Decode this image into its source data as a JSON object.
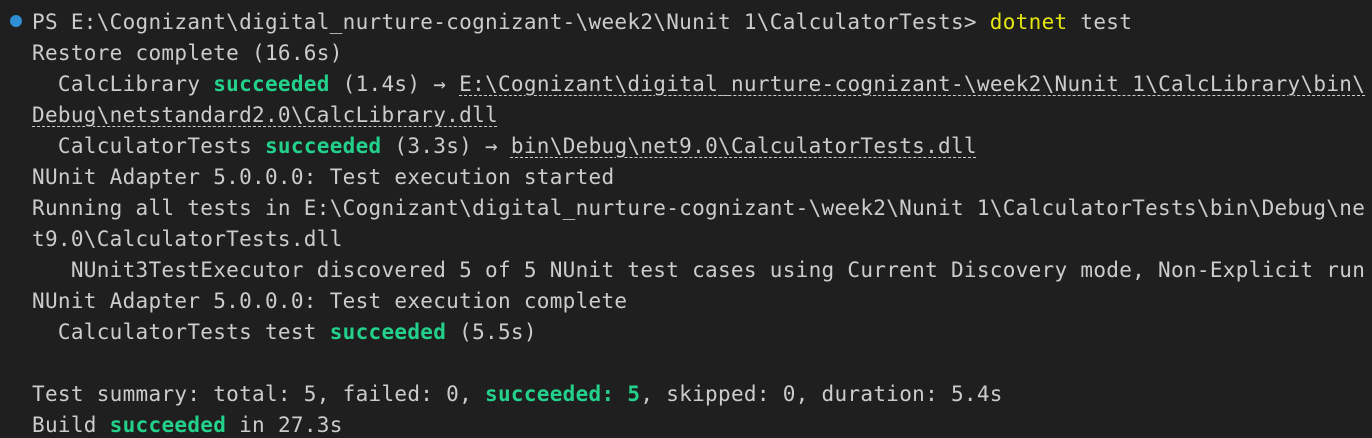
{
  "terminal": {
    "prompt": "PS E:\\Cognizant\\digital_nurture-cognizant-\\week2\\Nunit 1\\CalculatorTests> ",
    "command": "dotnet",
    "command_arg": " test",
    "restore": "Restore complete (16.6s)",
    "calclib": {
      "indent": "  ",
      "project": "CalcLibrary ",
      "status": "succeeded",
      "time": " (1.4s) → ",
      "path_line1": "E:\\Cognizant\\digital_nurture-cognizant-\\week2\\Nunit 1\\CalcLibrary\\bin\\",
      "path_line2": "Debug\\netstandard2.0\\CalcLibrary.dll"
    },
    "calctests": {
      "indent": "  ",
      "project": "CalculatorTests ",
      "status": "succeeded",
      "time": " (3.3s) → ",
      "path": "bin\\Debug\\net9.0\\CalculatorTests.dll"
    },
    "adapter_started": "NUnit Adapter 5.0.0.0: Test execution started",
    "running_line1": "Running all tests in E:\\Cognizant\\digital_nurture-cognizant-\\week2\\Nunit 1\\CalculatorTests\\bin\\Debug\\ne",
    "running_line2": "t9.0\\CalculatorTests.dll",
    "discovered": "   NUnit3TestExecutor discovered 5 of 5 NUnit test cases using Current Discovery mode, Non-Explicit run",
    "adapter_complete": "NUnit Adapter 5.0.0.0: Test execution complete",
    "test_result": {
      "indent": "  ",
      "prefix": "CalculatorTests test ",
      "status": "succeeded",
      "time": " (5.5s)"
    },
    "summary": {
      "prefix": "Test summary: total: 5, failed: 0, ",
      "succeeded": "succeeded: 5",
      "suffix": ", skipped: 0, duration: 5.4s"
    },
    "build": {
      "prefix": "Build ",
      "status": "succeeded",
      "suffix": " in 27.3s"
    }
  },
  "colors": {
    "background": "#1f1f1f",
    "text": "#cccccc",
    "command": "#e5e510",
    "success": "#23d18b",
    "prompt_dot": "#2f8fd3"
  }
}
